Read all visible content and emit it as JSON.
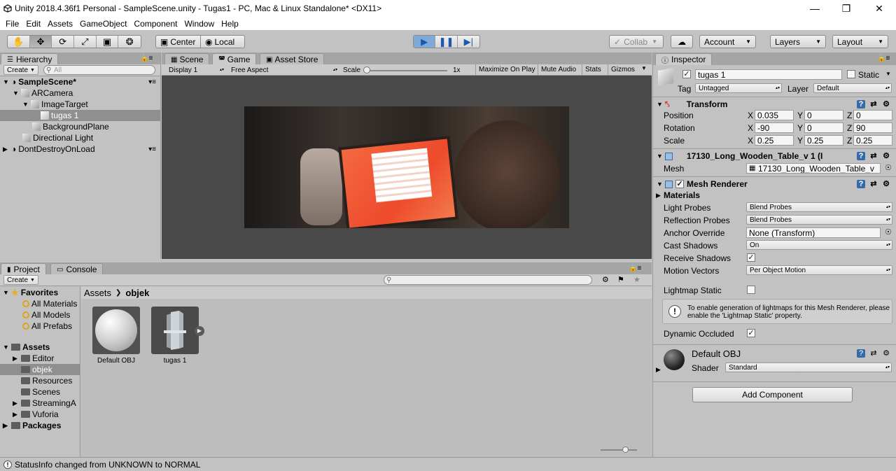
{
  "window": {
    "title": "Unity 2018.4.36f1 Personal - SampleScene.unity - Tugas1 - PC, Mac & Linux Standalone* <DX11>"
  },
  "menu": [
    "File",
    "Edit",
    "Assets",
    "GameObject",
    "Component",
    "Window",
    "Help"
  ],
  "toolbar": {
    "center_label": "Center",
    "local_label": "Local",
    "collab_label": "Collab",
    "account_label": "Account",
    "layers_label": "Layers",
    "layout_label": "Layout"
  },
  "hierarchy": {
    "tab": "Hierarchy",
    "create": "Create",
    "search_placeholder": "All",
    "items": [
      {
        "label": "SampleScene*"
      },
      {
        "label": "ARCamera"
      },
      {
        "label": "ImageTarget"
      },
      {
        "label": "tugas 1"
      },
      {
        "label": "BackgroundPlane"
      },
      {
        "label": "Directional Light"
      },
      {
        "label": "DontDestroyOnLoad"
      }
    ]
  },
  "scene_tabs": {
    "scene": "Scene",
    "game": "Game",
    "store": "Asset Store"
  },
  "game_bar": {
    "display": "Display 1",
    "aspect": "Free Aspect",
    "scale_label": "Scale",
    "scale_value": "1x",
    "maximize": "Maximize On Play",
    "mute": "Mute Audio",
    "stats": "Stats",
    "gizmos": "Gizmos"
  },
  "project": {
    "tab": "Project",
    "console_tab": "Console",
    "create": "Create",
    "breadcrumb": [
      "Assets",
      "objek"
    ],
    "favorites_label": "Favorites",
    "favorites": [
      "All Materials",
      "All Models",
      "All Prefabs"
    ],
    "assets_label": "Assets",
    "folders": [
      "Editor",
      "objek",
      "Resources",
      "Scenes",
      "StreamingA",
      "Vuforia"
    ],
    "packages_label": "Packages",
    "items": [
      {
        "label": "Default OBJ"
      },
      {
        "label": "tugas 1"
      }
    ]
  },
  "inspector": {
    "tab": "Inspector",
    "name": "tugas 1",
    "static_label": "Static",
    "tag_label": "Tag",
    "tag_value": "Untagged",
    "layer_label": "Layer",
    "layer_value": "Default",
    "transform": {
      "title": "Transform",
      "position": {
        "label": "Position",
        "x": "0.035",
        "y": "0",
        "z": "0"
      },
      "rotation": {
        "label": "Rotation",
        "x": "-90",
        "y": "0",
        "z": "90"
      },
      "scale": {
        "label": "Scale",
        "x": "0.25",
        "y": "0.25",
        "z": "0.25"
      }
    },
    "meshfilter": {
      "title": "17130_Long_Wooden_Table_v 1 (I",
      "mesh_label": "Mesh",
      "mesh_value": "17130_Long_Wooden_Table_v"
    },
    "renderer": {
      "title": "Mesh Renderer",
      "materials": "Materials",
      "light_probes_label": "Light Probes",
      "light_probes": "Blend Probes",
      "reflection_label": "Reflection Probes",
      "reflection": "Blend Probes",
      "anchor_label": "Anchor Override",
      "anchor": "None (Transform)",
      "cast_label": "Cast Shadows",
      "cast": "On",
      "receive_label": "Receive Shadows",
      "motion_label": "Motion Vectors",
      "motion": "Per Object Motion",
      "lightmap_label": "Lightmap Static",
      "info": "To enable generation of lightmaps for this Mesh Renderer, please enable the 'Lightmap Static' property.",
      "occluded_label": "Dynamic Occluded"
    },
    "material": {
      "name": "Default OBJ",
      "shader_label": "Shader",
      "shader": "Standard"
    },
    "add_component": "Add Component"
  },
  "status": {
    "text": "StatusInfo changed from UNKNOWN to NORMAL"
  }
}
